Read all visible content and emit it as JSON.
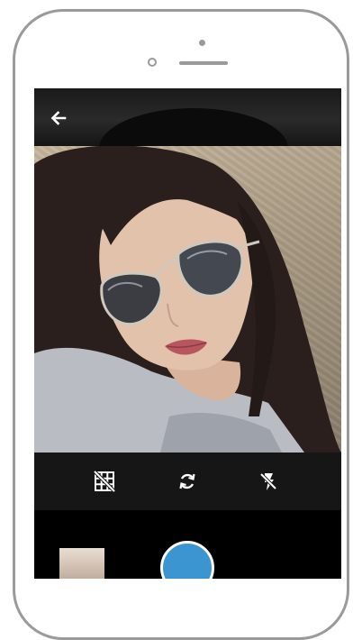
{
  "app": {
    "screen": "camera-preview"
  },
  "top_bar": {
    "back_icon": "arrow-left-icon"
  },
  "controls": [
    {
      "id": "grid",
      "icon": "grid-off-icon"
    },
    {
      "id": "switch-camera",
      "icon": "switch-camera-icon"
    },
    {
      "id": "flash",
      "icon": "flash-off-icon"
    }
  ],
  "bottom": {
    "thumbnail_icon": "gallery-thumbnail",
    "shutter_icon": "shutter-button"
  },
  "colors": {
    "shutter": "#3a95d0",
    "bars": "#161616",
    "device_frame": "#9a9a9a"
  }
}
